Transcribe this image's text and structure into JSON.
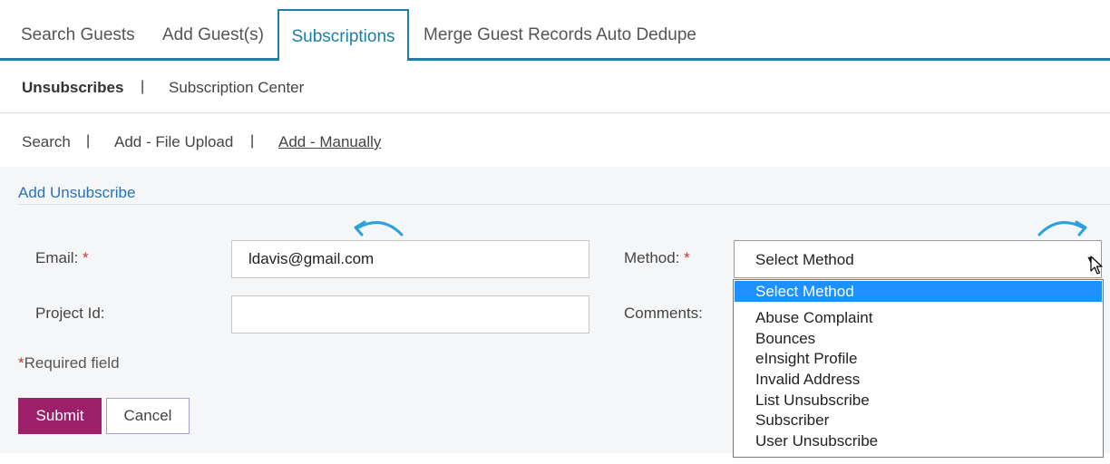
{
  "tabs": [
    {
      "label": "Search Guests",
      "active": false
    },
    {
      "label": "Add Guest(s)",
      "active": false
    },
    {
      "label": "Subscriptions",
      "active": true
    },
    {
      "label": "Merge Guest Records Auto Dedupe",
      "active": false
    }
  ],
  "subnav": {
    "unsubscribes": "Unsubscribes",
    "subscription_center": "Subscription Center",
    "separator": "|"
  },
  "thirdnav": {
    "search": "Search",
    "file_upload": "Add - File Upload",
    "manually": "Add - Manually",
    "separator": "|"
  },
  "form": {
    "title": "Add Unsubscribe",
    "email_label": "Email:",
    "email_value": "ldavis@gmail.com",
    "project_label": "Project Id:",
    "project_value": "",
    "method_label": "Method:",
    "method_selected": "Select Method",
    "comments_label": "Comments:",
    "required_star": "*",
    "required_note": "Required field",
    "submit_label": "Submit",
    "cancel_label": "Cancel"
  },
  "dropdown": {
    "options": [
      "Select Method",
      "Abuse Complaint",
      "Bounces",
      "eInsight Profile",
      "Invalid Address",
      "List Unsubscribe",
      "Subscriber",
      "User Unsubscribe"
    ],
    "highlighted": "Select Method"
  },
  "icons": {
    "caret": "caret-down-icon",
    "arrow_left": "curved-arrow-left-icon",
    "arrow_right": "curved-arrow-right-icon",
    "cursor": "mouse-pointer-icon"
  },
  "colors": {
    "accent": "#1e7fa6",
    "link": "#2a72b5",
    "submit": "#9c1f6a",
    "required": "#c0392b",
    "highlight": "#1e90ff",
    "arrow": "#2aa3dc"
  }
}
